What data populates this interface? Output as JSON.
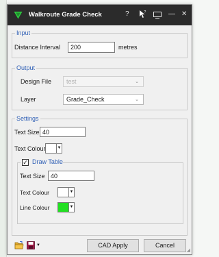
{
  "window": {
    "title": "Walkroute Grade Check",
    "help_glyph": "?",
    "minimize_glyph": "—",
    "close_glyph": "✕"
  },
  "input_group": {
    "legend": "Input",
    "distance_label": "Distance Interval",
    "distance_value": "200",
    "distance_unit": "metres"
  },
  "output_group": {
    "legend": "Output",
    "design_file_label": "Design File",
    "design_file_value": "test",
    "layer_label": "Layer",
    "layer_value": "Grade_Check"
  },
  "settings_group": {
    "legend": "Settings",
    "text_size_label": "Text Size",
    "text_size_value": "40",
    "text_colour_label": "Text Colour",
    "text_colour": "#ffffff"
  },
  "draw_table_group": {
    "legend": "Draw Table",
    "checked": true,
    "check_glyph": "✓",
    "text_size_label": "Text Size",
    "text_size_value": "40",
    "text_colour_label": "Text Colour",
    "text_colour": "#ffffff",
    "line_colour_label": "Line Colour",
    "line_colour": "#22e022"
  },
  "footer": {
    "cad_apply_label": "CAD Apply",
    "cancel_label": "Cancel"
  },
  "icons": {
    "dropdown_arrow": "▼",
    "chevron": "⌄"
  }
}
